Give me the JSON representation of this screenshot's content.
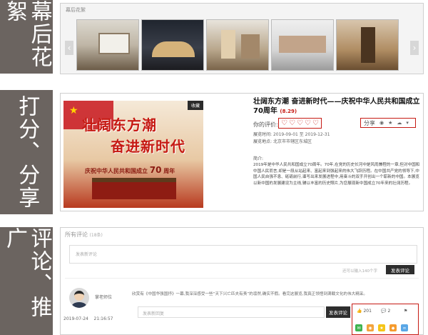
{
  "sections": {
    "behind_scenes": {
      "label": "幕后花絮",
      "panel_title": "幕后花絮",
      "prev": "‹",
      "next": "›"
    },
    "score_share": {
      "label": "打分、分享"
    },
    "comments_promo": {
      "label": "评论、推广"
    }
  },
  "event": {
    "badge": "收藏",
    "poster_line1": "壮阔东方潮",
    "poster_line2": "奋进新时代",
    "poster_sub": "庆祝中华人民共和国成立",
    "poster_sub_num": "70",
    "poster_sub_suffix": "周年",
    "title": "壮阔东方潮 奋进新时代——庆祝中华人民共和国成立70周年",
    "score": "(8.29)",
    "rating_label": "你的评价:",
    "hearts": [
      "♡",
      "♡",
      "♡",
      "♡",
      "♡"
    ],
    "share_label": "分享",
    "share_icons": [
      "weibo-icon",
      "star-icon",
      "wechat-icon",
      "more-icon"
    ],
    "date_label": "展览时间:",
    "date_value": "2019-09-01 至 2019-12-31",
    "place_label": "展览地点:",
    "place_value": "北京市市辖区东城区",
    "intro_label": "简介:",
    "intro": "2019年是中华人民共和国成立70周年。70年,在党的历史长河中是风雨兼程的一章,但对中国和中国人民而言,却是一段从站起来、富起来到强起来的伟大飞跃历程。在中国共产党的领导下,中国人民自强不息、砥砺前行,谱写出来发展进程中,用奋斗的双手开创出一个崭新的中国。本展览以新中国的发展建设为主线,辅以丰富的历史照片,为您展现新中国成立70年来的壮阔历程。"
  },
  "comments": {
    "title": "所有评论",
    "count": "(18条)",
    "input_placeholder": "发表新评论",
    "counter": "还可以输入140个字",
    "submit_label": "发表评论",
    "items": [
      {
        "user": "掌老师位",
        "date": "2019-07-24",
        "time": "21:16:57",
        "text": "欣赏有《中国华强国抒》一幕,我深深感受一些“天下兴亡匹夫有责”的凛然,确实不假。看完这展览,我真正领悟到满载文化的伟大精采。",
        "reply_placeholder": "发表新回复",
        "reply_label": "发表评论",
        "likes": "201",
        "replies": "2"
      }
    ],
    "share_icons": [
      "wechat-icon",
      "weibo-icon",
      "qzone-icon",
      "qq-icon",
      "link-icon"
    ]
  },
  "colors": {
    "accent": "#c61a13",
    "sidebar": "#6b6460",
    "button": "#2d2d2d"
  }
}
